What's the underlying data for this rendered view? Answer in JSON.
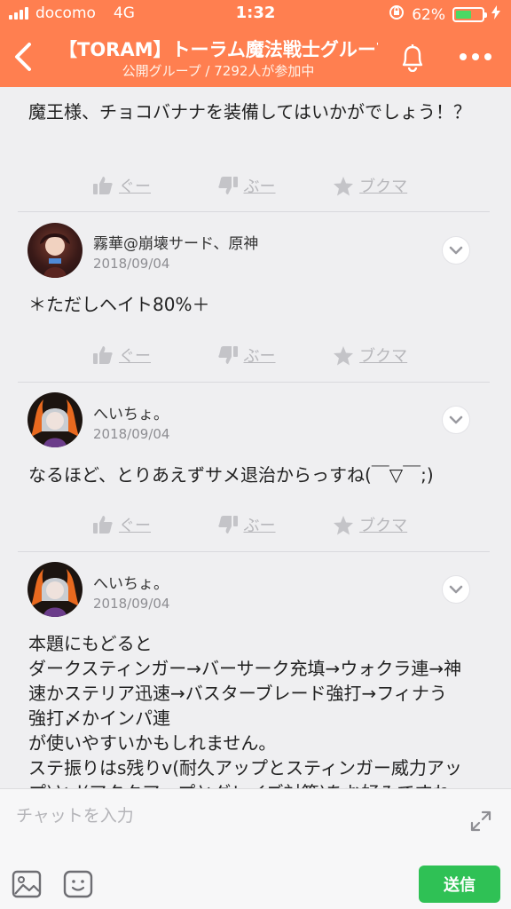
{
  "status_bar": {
    "carrier": "docomo",
    "network": "4G",
    "time": "1:32",
    "battery_percent": "62%",
    "battery_level": 0.62
  },
  "header": {
    "title": "【TORAM】トーラム魔法戦士グループ",
    "subtitle": "公開グループ / 7292人が参加中"
  },
  "actions": {
    "like_label": "ぐー",
    "dislike_label": "ぶー",
    "bookmark_label": "ブクマ"
  },
  "posts": [
    {
      "text": "魔王様、チョコバナナを装備してはいかがでしょう！？"
    },
    {
      "user": "霧華@崩壊サード、原神",
      "date": "2018/09/04",
      "text": "＊ただしヘイト80%＋"
    },
    {
      "user": "へいちょ。",
      "date": "2018/09/04",
      "text": "なるほど、とりあえずサメ退治からっすね(￣▽￣;)"
    },
    {
      "user": "へいちょ。",
      "date": "2018/09/04",
      "lines": [
        "本題にもどると",
        "ダークスティンガー→バーサーク充填→ウォクラ連→神",
        "速かステリア迅速→バスターブレード強打→フィナう",
        "強打〆かインパ連",
        "が使いやすいかもしれません。",
        "ステ振りはs残りv(耐久アップとスティンガー威力アッ",
        "プ)とd(アタクアップとグレイズ対策)をお好みですね"
      ]
    }
  ],
  "composer": {
    "placeholder": "チャットを入力",
    "send_label": "送信"
  },
  "colors": {
    "header": "#ff7f50",
    "send": "#2fc155"
  }
}
